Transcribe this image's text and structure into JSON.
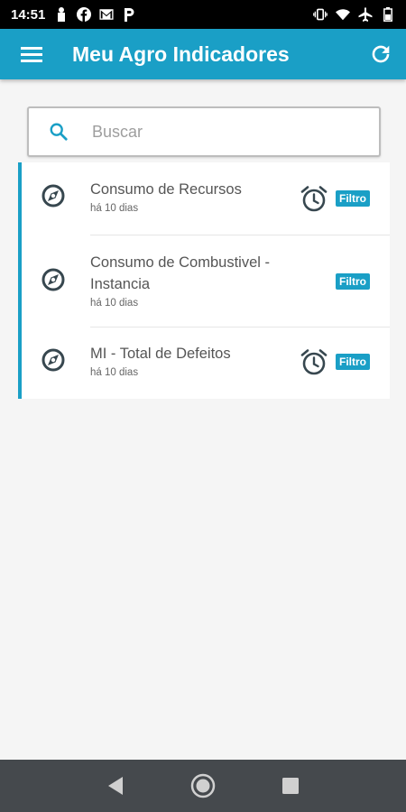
{
  "status_bar": {
    "time": "14:51",
    "left_icons": [
      "notification-icon",
      "facebook-icon",
      "gmail-icon",
      "parking-icon"
    ],
    "right_icons": [
      "vibrate-icon",
      "wifi-icon",
      "airplane-icon",
      "battery-icon"
    ]
  },
  "app_bar": {
    "title": "Meu Agro Indicadores",
    "menu_icon": "menu-icon",
    "refresh_icon": "refresh-icon"
  },
  "search": {
    "placeholder": "Buscar",
    "value": ""
  },
  "colors": {
    "primary": "#1a9fc6",
    "icon_dark": "#37474f",
    "nav_bar": "#45494d"
  },
  "items": [
    {
      "title": "Consumo de Recursos",
      "date": "há 10 dias",
      "has_alarm": true,
      "badge": "Filtro"
    },
    {
      "title": "Consumo de Combustivel - Instancia",
      "date": "há 10 dias",
      "has_alarm": false,
      "badge": "Filtro"
    },
    {
      "title": "MI - Total de Defeitos",
      "date": "há 10 dias",
      "has_alarm": true,
      "badge": "Filtro"
    }
  ],
  "nav_bar": {
    "buttons": [
      "back-icon",
      "home-icon",
      "recents-icon"
    ]
  }
}
